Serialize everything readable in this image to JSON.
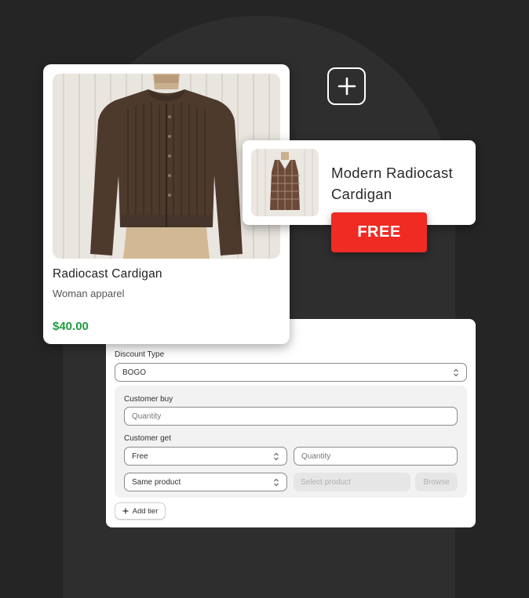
{
  "colors": {
    "background": "#252525",
    "arch": "#2e2e2e",
    "price_green": "#1f9d3f",
    "badge_red": "#ef2b24"
  },
  "add_button": {
    "icon": "plus-icon"
  },
  "product": {
    "name": "Radiocast Cardigan",
    "category": "Woman apparel",
    "price": "$40.00",
    "image": "brown-cardigan-on-mannequin"
  },
  "free_item": {
    "name": "Modern Radiocast Cardigan",
    "image": "plaid-vest-on-mannequin",
    "badge": "FREE"
  },
  "form": {
    "discount_type_label": "Discount Type",
    "discount_type_value": "BOGO",
    "customer_buy_label": "Customer buy",
    "buy_quantity_placeholder": "Quantity",
    "customer_get_label": "Customer get",
    "get_type_value": "Free",
    "get_quantity_placeholder": "Quantity",
    "get_product_value": "Same product",
    "select_product_placeholder": "Select product",
    "browse_label": "Browse",
    "add_tier_label": "Add tier"
  }
}
